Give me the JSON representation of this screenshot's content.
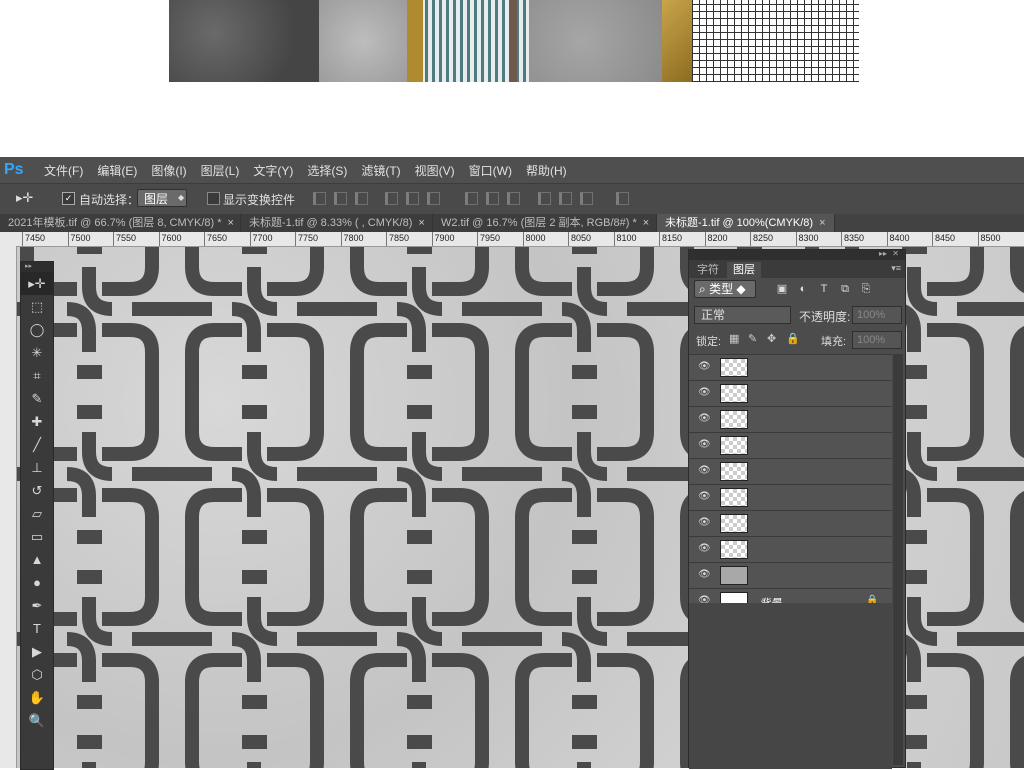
{
  "app": {
    "logo": "Ps",
    "menus": [
      "文件(F)",
      "编辑(E)",
      "图像(I)",
      "图层(L)",
      "文字(Y)",
      "选择(S)",
      "滤镜(T)",
      "视图(V)",
      "窗口(W)",
      "帮助(H)"
    ]
  },
  "options": {
    "move_icon": "move-tool-icon",
    "auto_select_checked": true,
    "auto_select_label": "自动选择：",
    "auto_select_target": "图层",
    "show_transform_label": "显示变换控件",
    "show_transform_checked": false
  },
  "tabs": [
    {
      "label": "2021年模板.tif @ 66.7% (图层 8, CMYK/8) *",
      "active": false
    },
    {
      "label": "未标题-1.tif @ 8.33% ( , CMYK/8)",
      "active": false
    },
    {
      "label": "W2.tif @ 16.7% (图层 2 副本, RGB/8#) *",
      "active": false
    },
    {
      "label": "未标题-1.tif @ 100%(CMYK/8)",
      "active": true
    }
  ],
  "tab_close": "×",
  "ruler_top_ticks": [
    "7450",
    "7500",
    "7550",
    "7600",
    "7650",
    "7700",
    "7750",
    "7800",
    "7850",
    "7900",
    "7950",
    "8000",
    "8050",
    "8100",
    "8150",
    "8200",
    "8250",
    "8300",
    "8350",
    "8400",
    "8450",
    "8500"
  ],
  "tools": [
    "move",
    "marquee",
    "lasso",
    "magic-wand",
    "crop",
    "eyedropper",
    "healing",
    "brush",
    "stamp",
    "history-brush",
    "eraser",
    "gradient",
    "blur",
    "dodge",
    "pen",
    "type",
    "path-select",
    "shape",
    "hand",
    "zoom"
  ],
  "tool_glyphs": [
    "▸✛",
    "⬚",
    "◯",
    "✳",
    "⌗",
    "✎",
    "✚",
    "╱",
    "⊥",
    "↺",
    "▱",
    "▭",
    "▲",
    "●",
    "✒",
    "T",
    "▶",
    "⬡",
    "✋",
    "🔍"
  ],
  "layers_panel": {
    "tabs": [
      "字符",
      "图层"
    ],
    "filter_label": "类型",
    "filter_icons": [
      "▣",
      "◐",
      "T",
      "⧉",
      "⎘"
    ],
    "blend_mode": "正常",
    "opacity_label": "不透明度:",
    "opacity_value": "100%",
    "lock_label": "锁定:",
    "lock_icons": [
      "▦",
      "✎",
      "✥",
      "🔒"
    ],
    "fill_label": "填充:",
    "fill_value": "100%",
    "layers": [
      {
        "name": "",
        "thumb": "checker",
        "visible": true
      },
      {
        "name": "",
        "thumb": "checker",
        "visible": true
      },
      {
        "name": "",
        "thumb": "checker",
        "visible": true
      },
      {
        "name": "",
        "thumb": "checker",
        "visible": true
      },
      {
        "name": "",
        "thumb": "checker",
        "visible": true
      },
      {
        "name": "",
        "thumb": "checker",
        "visible": true
      },
      {
        "name": "",
        "thumb": "checker",
        "visible": true
      },
      {
        "name": "",
        "thumb": "checker",
        "visible": true
      },
      {
        "name": "",
        "thumb": "gray",
        "visible": true
      },
      {
        "name": "背景",
        "thumb": "white",
        "visible": true,
        "locked": true
      }
    ]
  },
  "colors": {
    "ps_blue": "#30a8ff",
    "pattern_dark": "#4a4a4a",
    "panel_bg": "#535353"
  }
}
